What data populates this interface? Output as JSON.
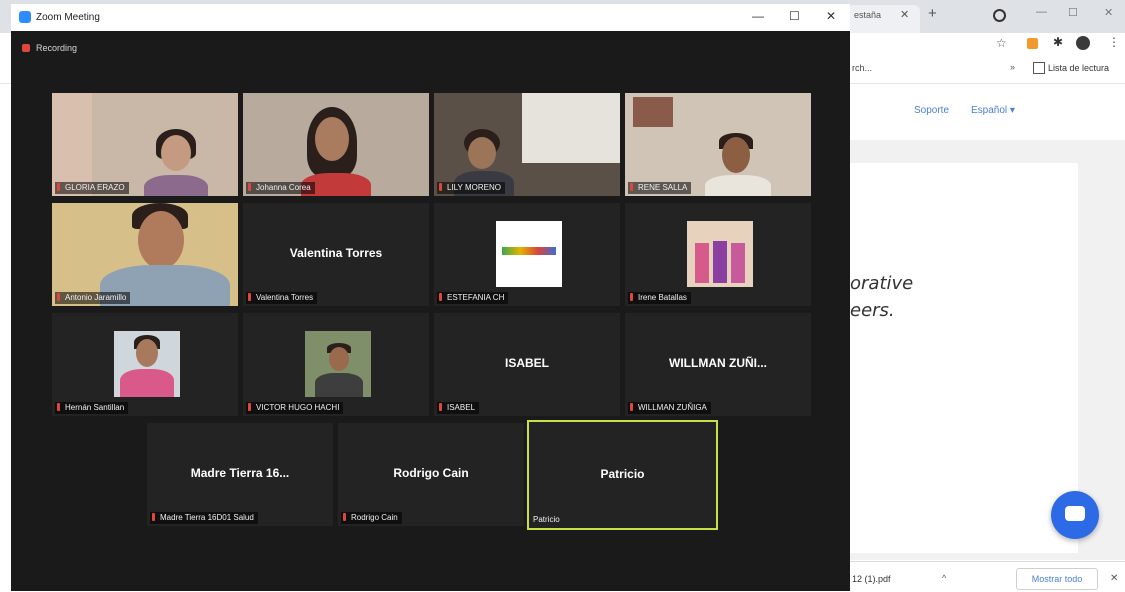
{
  "zoom": {
    "title": "Zoom Meeting",
    "controls": {
      "minimize": "—",
      "maximize": "☐",
      "close": "✕"
    },
    "recording_label": "Recording",
    "active_speaker_color": "#c7e045",
    "participants": [
      {
        "label": "GLORIA ERAZO",
        "center_name": ""
      },
      {
        "label": "Johanna Corea",
        "center_name": ""
      },
      {
        "label": "LILY MORENO",
        "center_name": ""
      },
      {
        "label": "RENE SALLA",
        "center_name": ""
      },
      {
        "label": "Antonio Jaramillo",
        "center_name": ""
      },
      {
        "label": "Valentina Torres",
        "center_name": "Valentina Torres"
      },
      {
        "label": "ESTEFANIA CH",
        "center_name": ""
      },
      {
        "label": "Irene Batallas",
        "center_name": ""
      },
      {
        "label": "Hernán Santillan",
        "center_name": ""
      },
      {
        "label": "VICTOR HUGO HACHI",
        "center_name": ""
      },
      {
        "label": "ISABEL",
        "center_name": "ISABEL"
      },
      {
        "label": "WILLMAN ZUÑIGA",
        "center_name": "WILLMAN ZUÑI..."
      },
      {
        "label": "Madre Tierra 16D01 Salud",
        "center_name": "Madre Tierra 16..."
      },
      {
        "label": "Rodrigo Cain",
        "center_name": "Rodrigo Cain"
      },
      {
        "label": "Patricio",
        "center_name": "Patricio"
      }
    ]
  },
  "browser": {
    "tab_title": "estaña",
    "tab_close": "✕",
    "new_tab": "+",
    "window_controls": {
      "minimize": "—",
      "maximize": "☐",
      "close": "✕"
    },
    "bookmark_fragment": "rch...",
    "reading_list": "Lista de lectura",
    "site_links": [
      "Soporte",
      "Español ▾"
    ],
    "page_text_1": "orative",
    "page_text_2": "eers.",
    "download_file": "12 (1).pdf",
    "show_all": "Mostrar todo",
    "download_close": "✕"
  }
}
